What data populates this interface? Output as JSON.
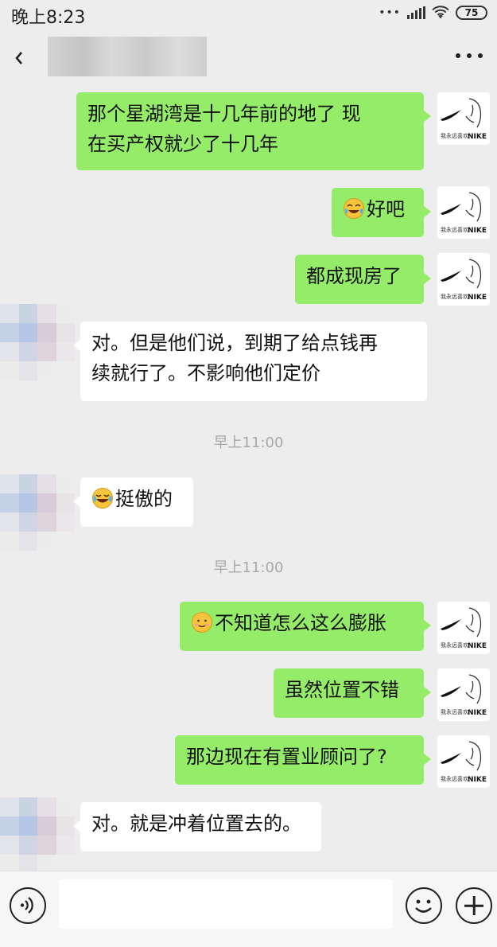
{
  "status_bar": {
    "time": "晚上8:23",
    "battery": "75"
  },
  "header": {
    "contact_name": "",
    "more_icon": "more-dots-icon",
    "back_icon": "chevron-left-icon"
  },
  "messages": [
    {
      "side": "out",
      "lines": [
        "那个星湖湾是十几年前的地了  现",
        "在买产权就少了十几年"
      ]
    },
    {
      "side": "out",
      "emoji": "laughing-crying-emoji",
      "text": "好吧"
    },
    {
      "side": "out",
      "text": "都成现房了"
    },
    {
      "side": "in",
      "lines": [
        "对。但是他们说，到期了给点钱再",
        "续就行了。不影响他们定价"
      ]
    },
    {
      "side": "time",
      "text": "早上11:00"
    },
    {
      "side": "in",
      "emoji": "tears-of-joy-emoji",
      "text": "挺傲的"
    },
    {
      "side": "time",
      "text": "早上11:00"
    },
    {
      "side": "out",
      "emoji": "awkward-smile-emoji",
      "text": "不知道怎么这么膨胀"
    },
    {
      "side": "out",
      "text": "虽然位置不错"
    },
    {
      "side": "out",
      "text": "那边现在有置业顾问了?"
    },
    {
      "side": "in",
      "text": "对。就是冲着位置去的。"
    }
  ],
  "self_avatar": {
    "caption": "我永远喜欢",
    "logo": "NIKE"
  },
  "input_bar": {
    "placeholder": "",
    "voice_icon": "voice-icon",
    "emoji_icon": "smiley-icon",
    "plus_icon": "plus-icon"
  },
  "colors": {
    "outgoing_bubble": "#95ec69",
    "incoming_bubble": "#ffffff",
    "background": "#ededed"
  }
}
